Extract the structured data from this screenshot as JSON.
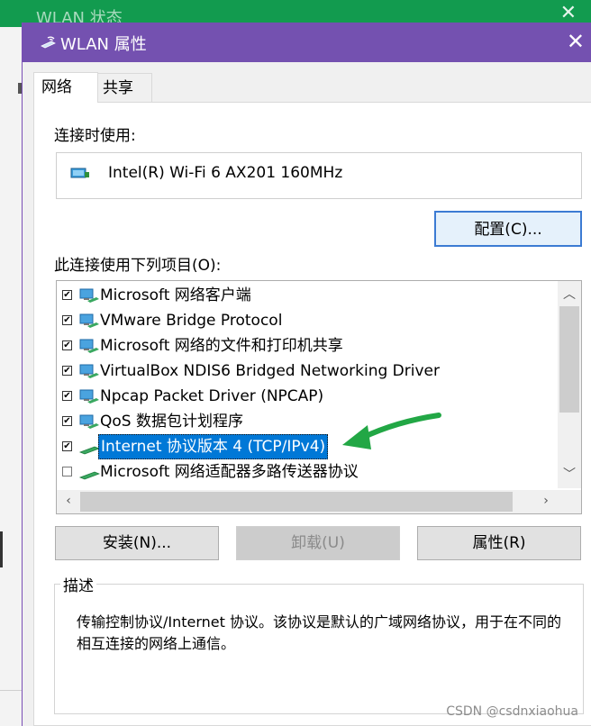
{
  "background_window": {
    "title": "WLAN 状态"
  },
  "dialog": {
    "title": "WLAN 属性",
    "close_glyph": "✕",
    "tabs": [
      {
        "label": "网络",
        "active": true
      },
      {
        "label": "共享",
        "active": false
      }
    ],
    "connect_using_label": "连接时使用:",
    "adapter_name": "Intel(R) Wi-Fi 6 AX201 160MHz",
    "configure_button": "配置(C)...",
    "items_label": "此连接使用下列项目(O):",
    "items": [
      {
        "label": "Microsoft 网络客户端",
        "checked": true,
        "icon": "network-client-icon"
      },
      {
        "label": "VMware Bridge Protocol",
        "checked": true,
        "icon": "network-service-icon"
      },
      {
        "label": "Microsoft 网络的文件和打印机共享",
        "checked": true,
        "icon": "network-service-icon"
      },
      {
        "label": "VirtualBox NDIS6 Bridged Networking Driver",
        "checked": true,
        "icon": "network-service-icon"
      },
      {
        "label": "Npcap Packet Driver (NPCAP)",
        "checked": true,
        "icon": "network-service-icon"
      },
      {
        "label": "QoS 数据包计划程序",
        "checked": true,
        "icon": "network-service-icon"
      },
      {
        "label": "Internet 协议版本 4 (TCP/IPv4)",
        "checked": true,
        "selected": true,
        "icon": "protocol-icon"
      },
      {
        "label": "Microsoft 网络适配器多路传送器协议",
        "checked": false,
        "icon": "protocol-icon"
      }
    ],
    "install_button": "安装(N)...",
    "uninstall_button": "卸载(U)",
    "properties_button": "属性(R)",
    "description_title": "描述",
    "description_text": "传输控制协议/Internet 协议。该协议是默认的广域网络协议，用于在不同的相互连接的网络上通信。"
  },
  "watermark": "CSDN @csdnxiaohua",
  "colors": {
    "titlebar": "#7451b0",
    "selection": "#0078d7",
    "annotation_arrow": "#22a745",
    "background_titlebar": "#129b4f"
  }
}
